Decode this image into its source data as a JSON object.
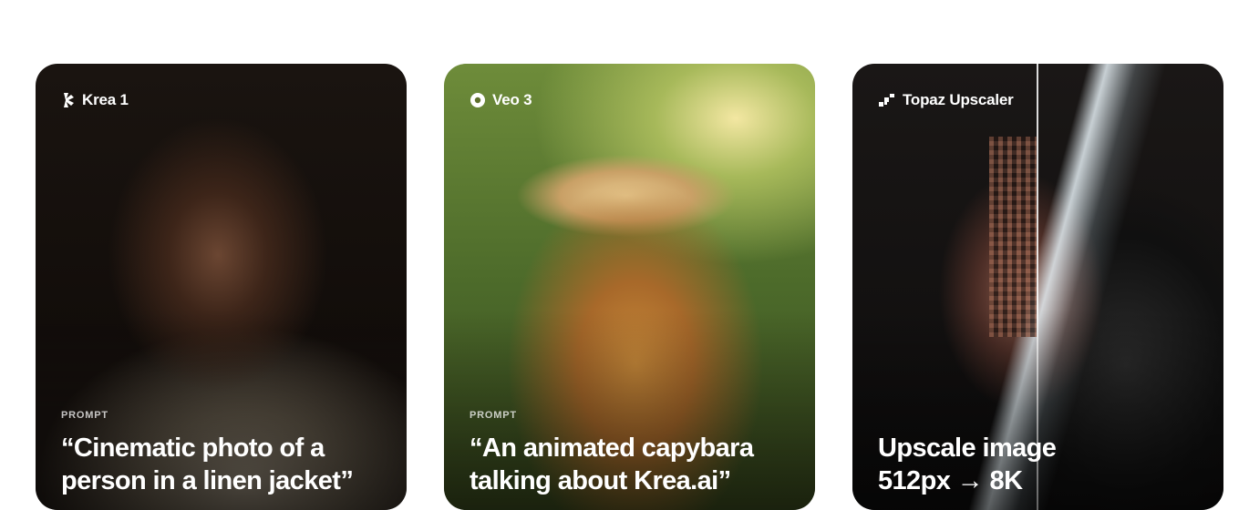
{
  "cards": [
    {
      "model": "Krea 1",
      "model_icon": "krea-logo-icon",
      "label": "PROMPT",
      "text_lines": [
        "“Cinematic photo of a",
        "person in a linen jacket”"
      ]
    },
    {
      "model": "Veo 3",
      "model_icon": "veo-logo-icon",
      "label": "PROMPT",
      "text_lines": [
        "“An animated capybara",
        "talking about Krea.ai”"
      ]
    },
    {
      "model": "Topaz Upscaler",
      "model_icon": "topaz-logo-icon",
      "label": "",
      "text_lines": [
        "Upscale image",
        "512px → 8K"
      ]
    }
  ]
}
